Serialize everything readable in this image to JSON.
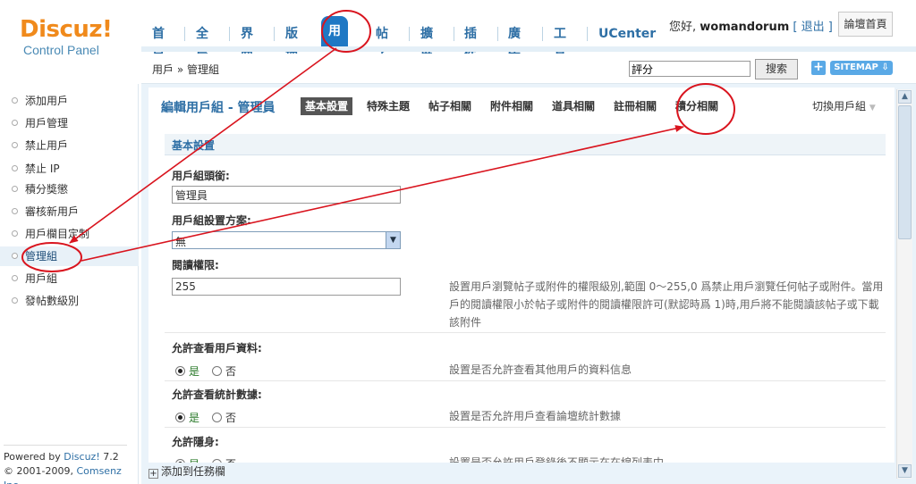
{
  "header": {
    "logo_main": "Discuz!",
    "logo_sub": "Control Panel",
    "nav": [
      "首頁",
      "全局",
      "界面",
      "版塊",
      "用戶",
      "帖子",
      "擴展",
      "插件",
      "廣告",
      "工具",
      "UCenter"
    ],
    "greeting": "您好,",
    "username": "womandorum",
    "logout": "[ 退出 ]",
    "forum_home": "論壇首頁"
  },
  "crumb": {
    "path": "用戶 » 管理組",
    "search_value": "評分",
    "search_button": "搜索",
    "plus": "+",
    "sitemap": "SITEMAP ⇩"
  },
  "sidebar": {
    "items": [
      "添加用戶",
      "用戶管理",
      "禁止用戶",
      "禁止 IP",
      "積分獎懲",
      "審核新用戶",
      "用戶欄目定制",
      "管理組",
      "用戶組",
      "發帖數級別"
    ],
    "powered_prefix": "Powered by ",
    "powered_link": "Discuz!",
    "version": " 7.2",
    "copyright_prefix": "© 2001-2009, ",
    "copyright_link": "Comsenz Inc."
  },
  "content": {
    "title": "編輯用戶組 - 管理員",
    "tabs": [
      "基本設置",
      "特殊主題",
      "帖子相關",
      "附件相關",
      "道具相關",
      "註冊相關",
      "積分相關"
    ],
    "switch_group": "切換用戶組",
    "section_title": "基本設置",
    "fields": {
      "group_title_label": "用戶組頭銜:",
      "group_title_value": "管理員",
      "scheme_label": "用戶組設置方案:",
      "scheme_value": "無",
      "read_label": "閱讀權限:",
      "read_value": "255",
      "read_hint": "設置用戶瀏覽帖子或附件的權限級別,範圍 0～255,0 爲禁止用戶瀏覽任何帖子或附件。當用戶的閱讀權限小於帖子或附件的閱讀權限許可(默認時爲 1)時,用戶將不能閱讀該帖子或下載該附件",
      "view_profile_label": "允許查看用戶資料:",
      "view_profile_hint": "設置是否允許查看其他用戶的資料信息",
      "view_stats_label": "允許查看統計數據:",
      "view_stats_hint": "設置是否允許用戶查看論壇統計數據",
      "invisible_label": "允許隱身:",
      "invisible_hint": "設置是否允許用戶登錄後不顯示在在線列表中",
      "yes": "是",
      "no": "否"
    },
    "taskbar_add": "添加到任務欄"
  },
  "colors": {
    "accent": "#2e6fa5",
    "active_nav": "#1f78c4",
    "annotation": "#d9141e",
    "logo_orange": "#f08a1c"
  }
}
